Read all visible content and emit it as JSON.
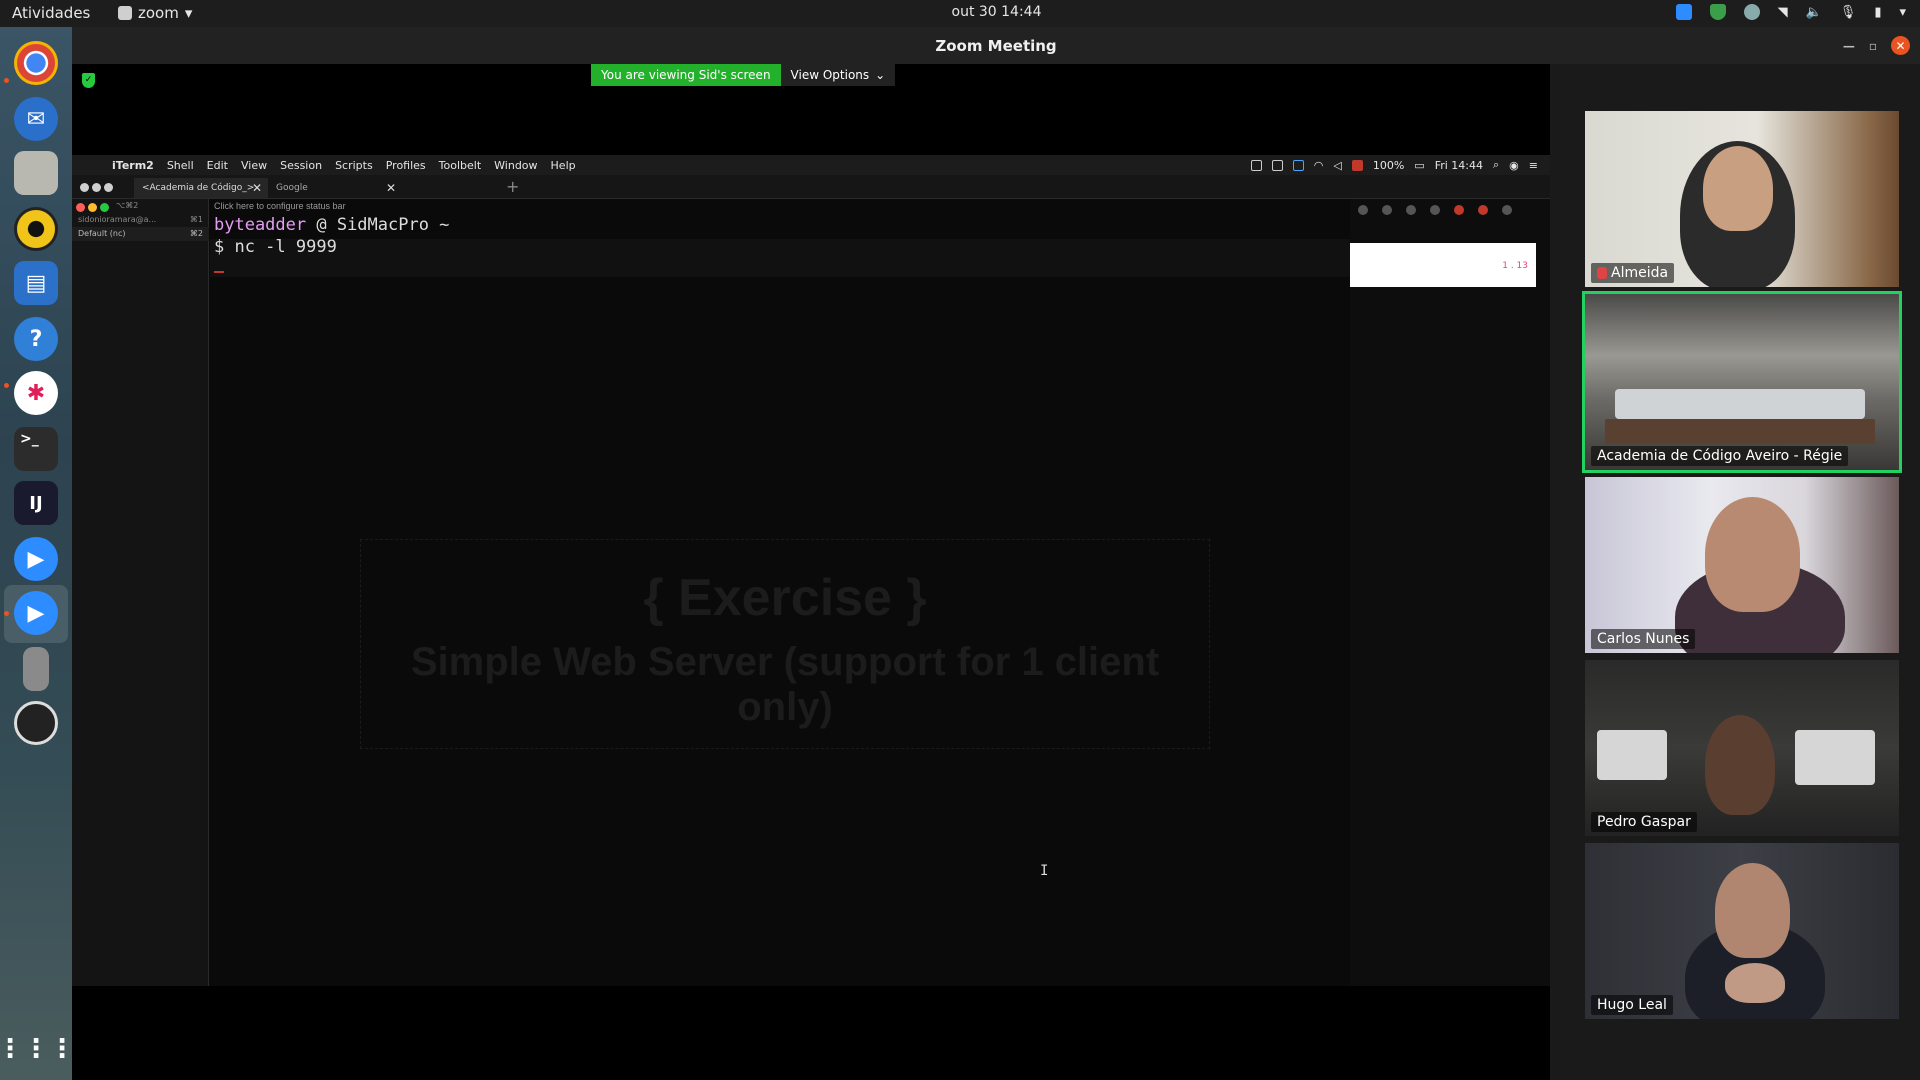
{
  "topbar": {
    "activities": "Atividades",
    "app_name": "zoom",
    "clock": "out 30  14:44"
  },
  "zoom": {
    "window_title": "Zoom Meeting",
    "viewing_banner": "You are viewing Sid's screen",
    "view_options": "View Options"
  },
  "mac": {
    "app_menu": [
      "iTerm2",
      "Shell",
      "Edit",
      "View",
      "Session",
      "Scripts",
      "Profiles",
      "Toolbelt",
      "Window",
      "Help"
    ],
    "battery": "100%",
    "time": "Fri 14:44"
  },
  "iterm": {
    "tabs": [
      {
        "label": "<Academia de Código_>"
      },
      {
        "label": "Google"
      }
    ],
    "side_shortcut_1": "⌥⌘2",
    "side_row_1": "sidonioramara@a...",
    "side_row_1_key": "⌘1",
    "side_row_2": "Default (nc)",
    "side_row_2_key": "⌘2",
    "status_hint": "Click here to configure status bar",
    "prompt_user": "byteadder",
    "prompt_host": " @ SidMacPro ~",
    "command": "$ nc -l 9999",
    "right_panel_value": "1 . 13"
  },
  "exercise": {
    "title": "{ Exercise }",
    "subtitle": "Simple Web Server (support for 1 client only)"
  },
  "participants": [
    {
      "name": "Almeida",
      "muted": true
    },
    {
      "name": "Academia de Código Aveiro - Régie",
      "muted": false,
      "active_speaker": true
    },
    {
      "name": "Carlos Nunes",
      "muted": false
    },
    {
      "name": "Pedro Gaspar",
      "muted": false
    },
    {
      "name": "Hugo Leal",
      "muted": false
    }
  ],
  "colors": {
    "zoom_green": "#23b12b",
    "active_speaker_outline": "#23d160",
    "ubuntu_orange": "#e95420"
  }
}
